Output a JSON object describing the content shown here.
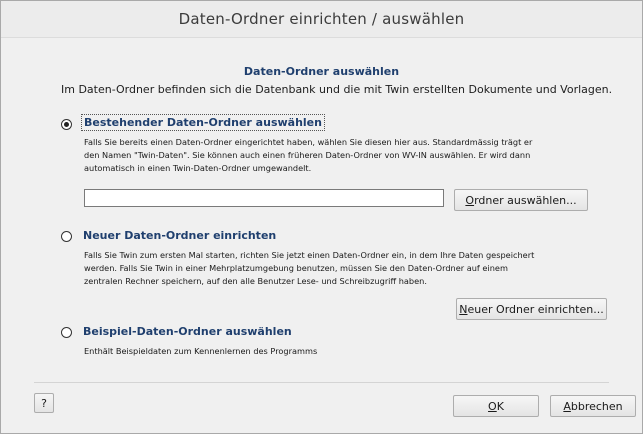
{
  "window": {
    "title": "Daten-Ordner einrichten / auswählen"
  },
  "section": {
    "title": "Daten-Ordner auswählen",
    "intro": "Im Daten-Ordner befinden sich die Datenbank und die mit Twin erstellten Dokumente und Vorlagen."
  },
  "options": [
    {
      "title": "Bestehender Daten-Ordner auswählen",
      "selected": true,
      "desc_lines": [
        "Falls Sie bereits einen Daten-Ordner eingerichtet haben, wählen Sie diesen hier aus. Standardmässig trägt er",
        "den Namen \"Twin-Daten\". Sie können auch einen früheren Daten-Ordner von WV-IN auswählen. Er wird dann",
        "automatisch in einen Twin-Daten-Ordner umgewandelt."
      ]
    },
    {
      "title": "Neuer Daten-Ordner einrichten",
      "selected": false,
      "desc_lines": [
        "Falls Sie Twin zum ersten Mal starten, richten Sie jetzt einen Daten-Ordner ein, in dem Ihre Daten gespeichert",
        "werden. Falls Sie Twin in einer Mehrplatzumgebung benutzen, müssen Sie den Daten-Ordner auf einem",
        "zentralen Rechner speichern, auf den alle Benutzer Lese- und Schreibzugriff haben."
      ]
    },
    {
      "title": "Beispiel-Daten-Ordner auswählen",
      "selected": false,
      "desc_lines": [
        "Enthält Beispieldaten zum Kennenlernen des Programms"
      ]
    }
  ],
  "folder_input": {
    "value": ""
  },
  "buttons": {
    "select_folder": {
      "mnemonic": "O",
      "rest": "rdner auswählen..."
    },
    "new_folder": {
      "mnemonic": "N",
      "rest": "euer Ordner einrichten..."
    },
    "help": "?",
    "ok": {
      "mnemonic": "O",
      "rest": "K"
    },
    "cancel": {
      "mnemonic": "A",
      "rest": "bbrechen"
    }
  }
}
